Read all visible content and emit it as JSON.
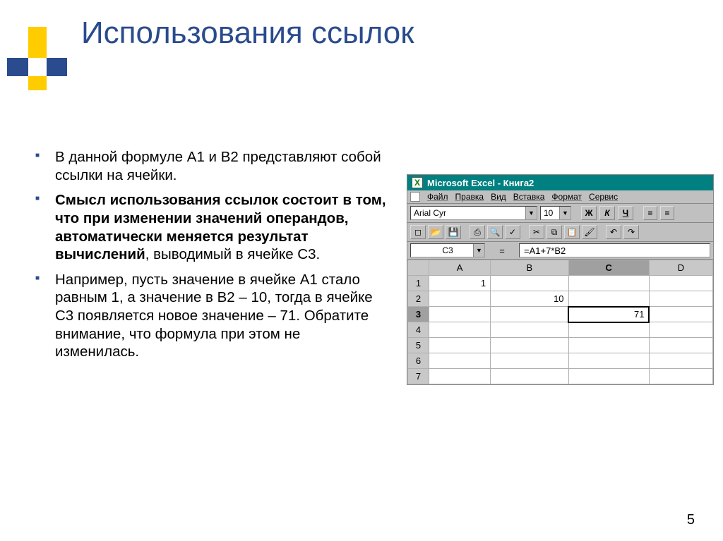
{
  "title": "Использования ссылок",
  "bullets": {
    "b1": "В данной формуле A1 и B2 представляют собой ссылки на ячейки.",
    "b2_pre": "Смысл использования ссылок состоит в том, что при изменении значений операндов, автоматически меняется результат вычислений",
    "b2_post": ", выводимый в ячейке C3.",
    "b3": "Например, пусть значение в ячейке A1 стало равным 1, а значение в B2 – 10, тогда в ячейке C3 появляется новое значение – 71. Обратите внимание, что формула при этом не изменилась."
  },
  "excel": {
    "title": "Microsoft Excel - Книга2",
    "menus": {
      "file": "Файл",
      "edit": "Правка",
      "view": "Вид",
      "insert": "Вставка",
      "format": "Формат",
      "tools": "Сервис"
    },
    "font_name": "Arial Cyr",
    "font_size": "10",
    "style": {
      "bold": "Ж",
      "italic": "К",
      "underline": "Ч"
    },
    "name_box": "C3",
    "eq": "=",
    "formula": "=A1+7*B2",
    "cols": [
      "A",
      "B",
      "C",
      "D"
    ],
    "rows": [
      "1",
      "2",
      "3",
      "4",
      "5",
      "6",
      "7"
    ],
    "cells": {
      "A1": "1",
      "B2": "10",
      "C3": "71"
    }
  },
  "page_number": "5"
}
